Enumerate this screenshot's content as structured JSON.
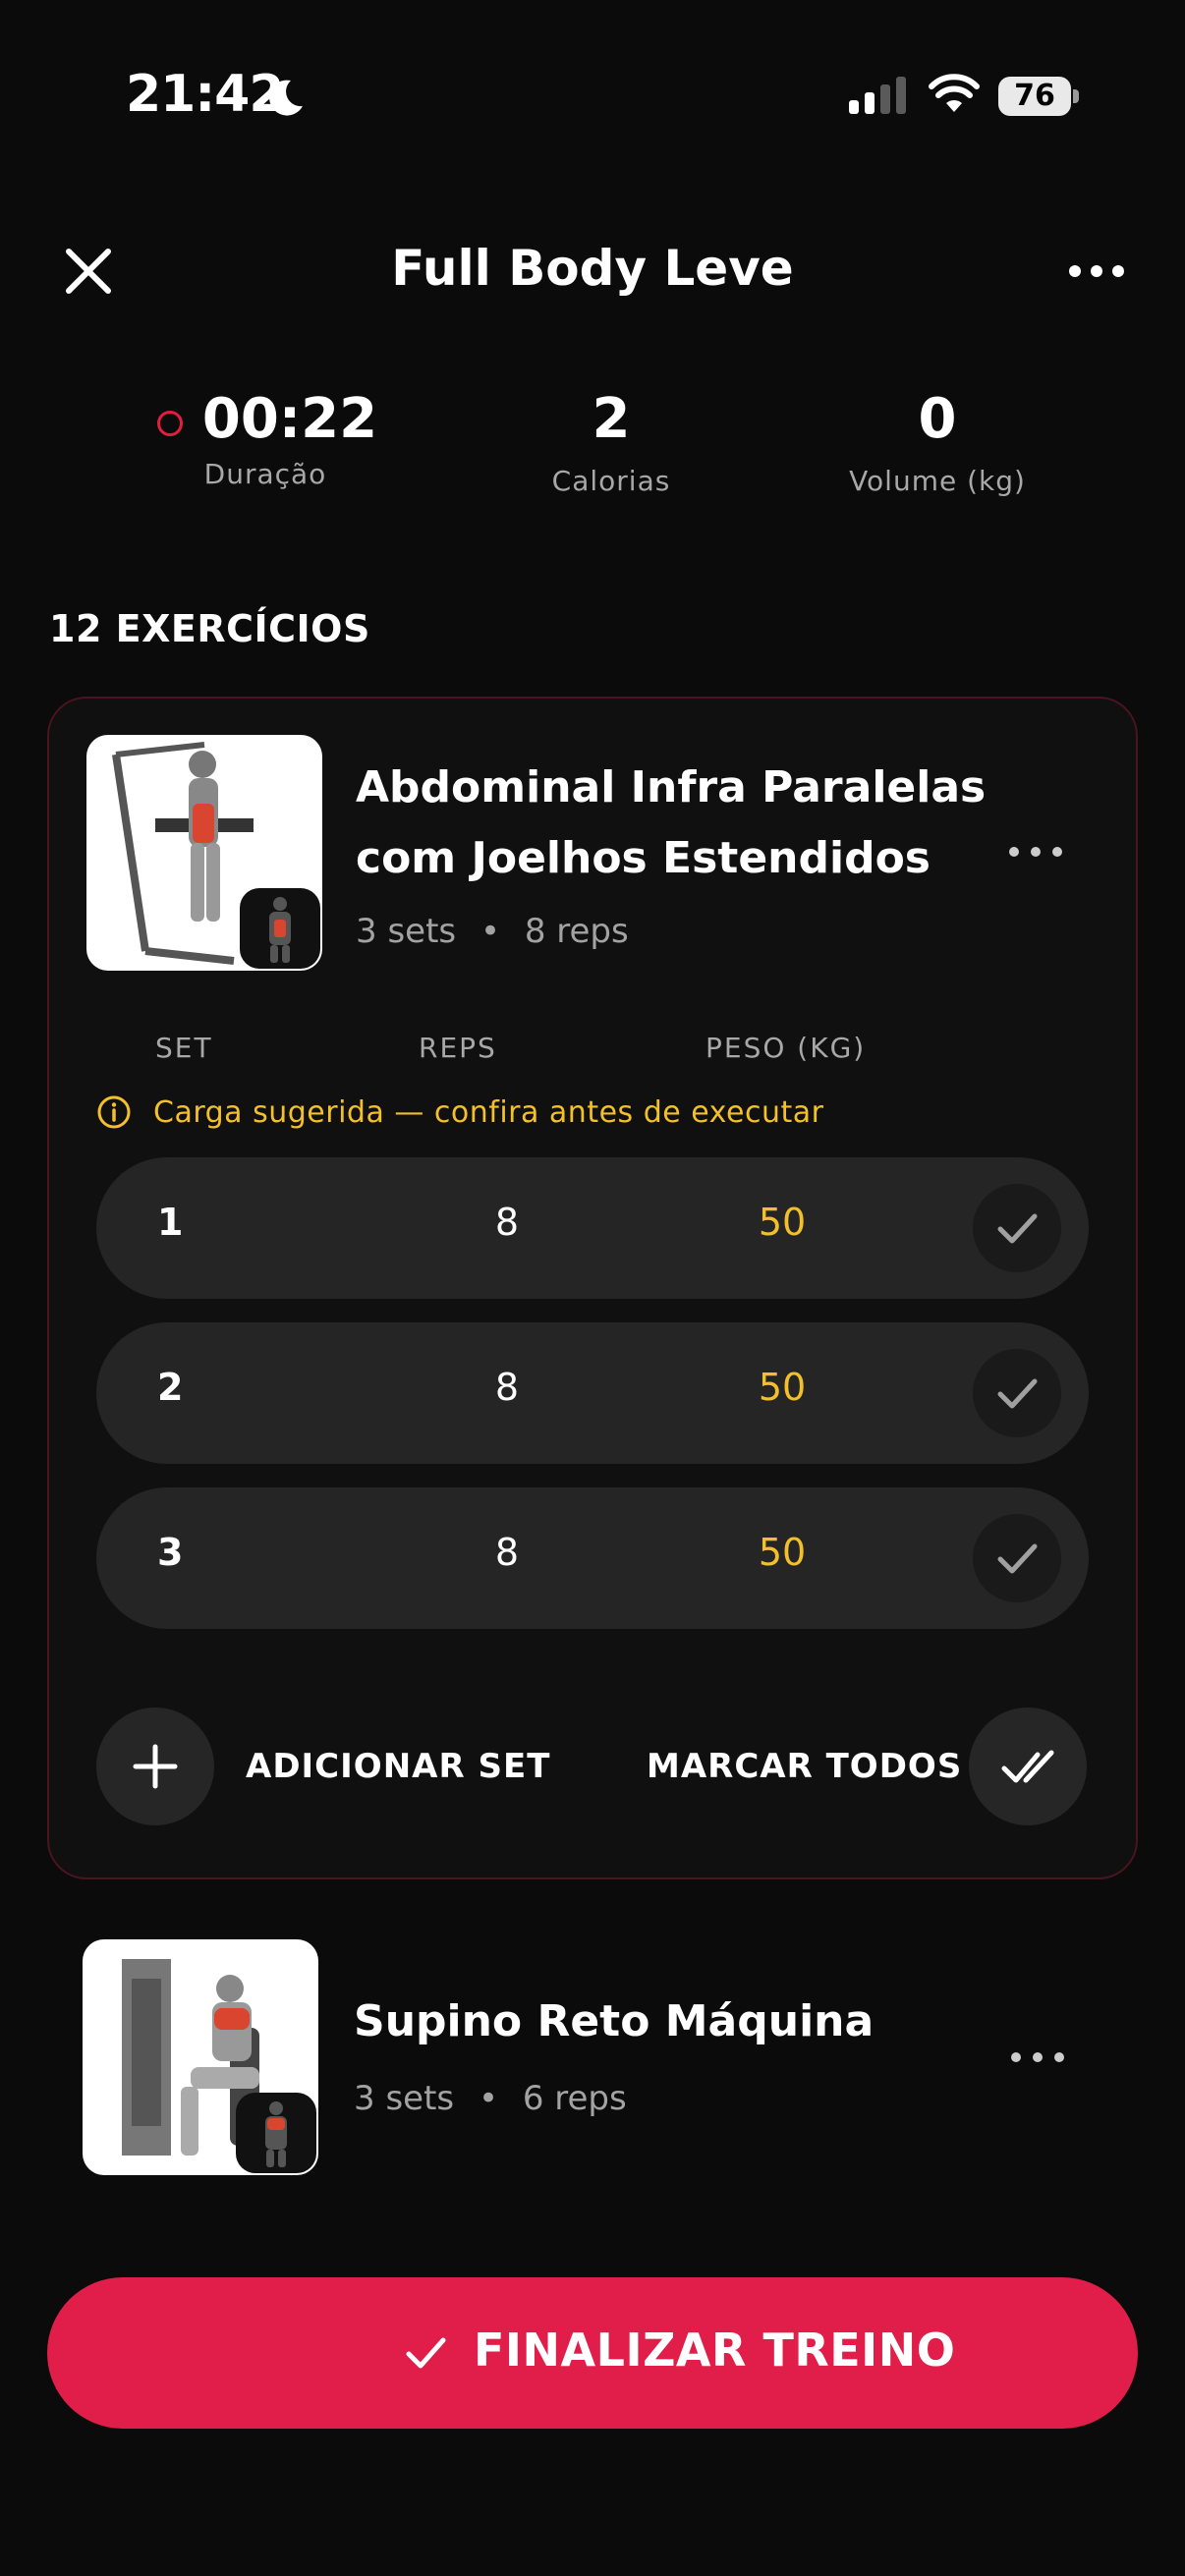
{
  "status_bar": {
    "time": "21:42",
    "battery": "76"
  },
  "header": {
    "title": "Full Body Leve"
  },
  "stats": [
    {
      "value": "00:22",
      "label": "Duração"
    },
    {
      "value": "2",
      "label": "Calorias"
    },
    {
      "value": "0",
      "label": "Volume (kg)"
    }
  ],
  "section": {
    "title": "12 EXERCÍCIOS"
  },
  "exercises": [
    {
      "name_line1": "Abdominal Infra Paralelas",
      "name_line2": "com Joelhos Estendidos",
      "sets": "3 sets",
      "reps": "8 reps",
      "columns": {
        "set": "SET",
        "reps": "REPS",
        "weight": "PESO (KG)"
      },
      "hint": "Carga sugerida — confira antes de executar",
      "rows": [
        {
          "set": "1",
          "reps": "8",
          "weight": "50"
        },
        {
          "set": "2",
          "reps": "8",
          "weight": "50"
        },
        {
          "set": "3",
          "reps": "8",
          "weight": "50"
        }
      ],
      "add_set_label": "ADICIONAR SET",
      "mark_all_label": "MARCAR TODOS"
    },
    {
      "name": "Supino Reto Máquina",
      "sets": "3 sets",
      "reps": "6 reps"
    }
  ],
  "finish_button": {
    "label": "FINALIZAR TREINO"
  },
  "colors": {
    "accent": "#e01e49",
    "warning": "#f3c02b",
    "background": "#0b0b0c",
    "row": "#252525"
  },
  "icons": [
    "moon-icon",
    "signal-icon",
    "wifi-icon",
    "battery-icon",
    "close-icon",
    "more-icon",
    "recording-dot-icon",
    "info-icon",
    "check-icon",
    "plus-icon",
    "double-check-icon",
    "muscle-icon"
  ]
}
